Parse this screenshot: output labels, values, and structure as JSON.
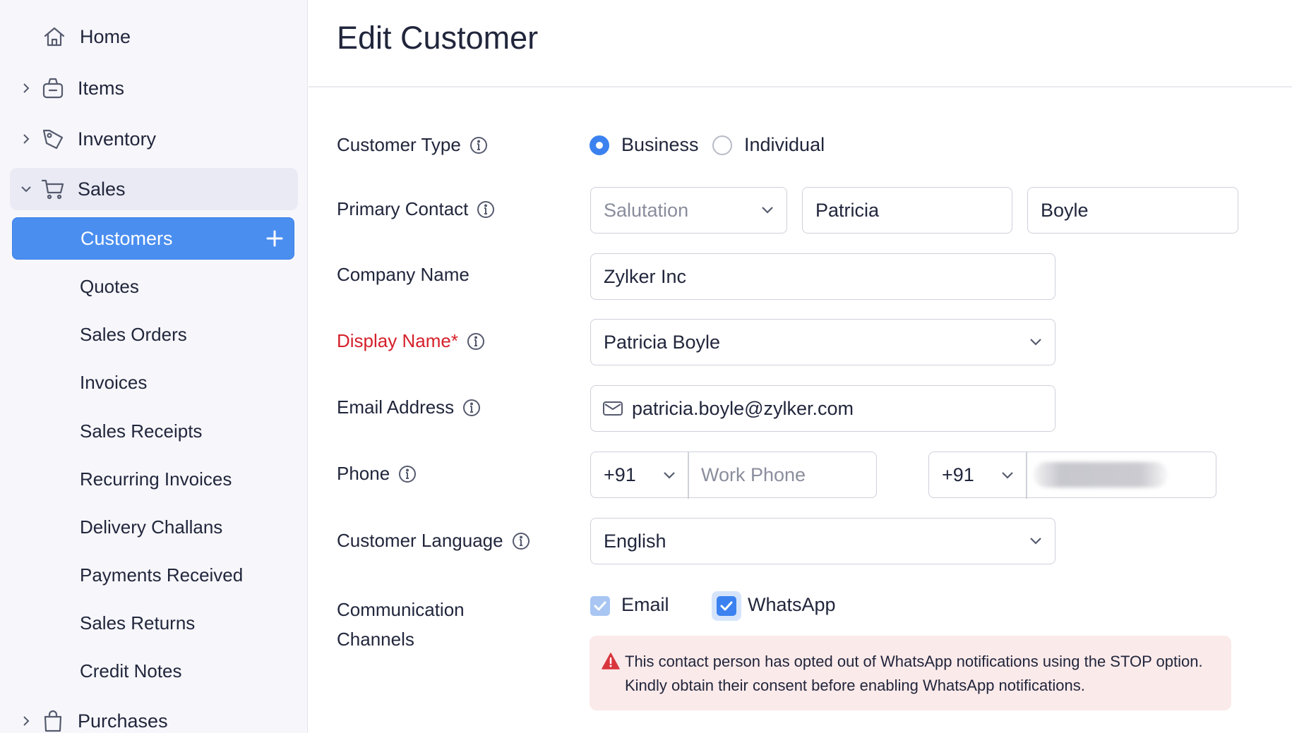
{
  "sidebar": {
    "items": [
      {
        "label": "Home",
        "icon": "home-icon"
      },
      {
        "label": "Items",
        "icon": "basket-icon"
      },
      {
        "label": "Inventory",
        "icon": "tag-icon"
      },
      {
        "label": "Sales",
        "icon": "cart-icon"
      },
      {
        "label": "Purchases",
        "icon": "shopping-bag-icon"
      }
    ],
    "sales_sub": [
      {
        "label": "Customers",
        "active": true
      },
      {
        "label": "Quotes"
      },
      {
        "label": "Sales Orders"
      },
      {
        "label": "Invoices"
      },
      {
        "label": "Sales Receipts"
      },
      {
        "label": "Recurring Invoices"
      },
      {
        "label": "Delivery Challans"
      },
      {
        "label": "Payments Received"
      },
      {
        "label": "Sales Returns"
      },
      {
        "label": "Credit Notes"
      }
    ]
  },
  "page": {
    "title": "Edit Customer"
  },
  "form": {
    "customer_type": {
      "label": "Customer Type",
      "options": [
        "Business",
        "Individual"
      ],
      "selected": "Business"
    },
    "primary_contact": {
      "label": "Primary Contact",
      "salutation_placeholder": "Salutation",
      "first_name": "Patricia",
      "last_name": "Boyle"
    },
    "company_name": {
      "label": "Company Name",
      "value": "Zylker Inc"
    },
    "display_name": {
      "label": "Display Name*",
      "value": "Patricia Boyle"
    },
    "email": {
      "label": "Email Address",
      "value": "patricia.boyle@zylker.com"
    },
    "phone": {
      "label": "Phone",
      "work_code": "+91",
      "work_placeholder": "Work Phone",
      "mobile_code": "+91"
    },
    "language": {
      "label": "Customer Language",
      "value": "English"
    },
    "channels": {
      "label_line1": "Communication",
      "label_line2": "Channels",
      "email_label": "Email",
      "email_checked": true,
      "whatsapp_label": "WhatsApp",
      "whatsapp_checked": true
    },
    "alert": {
      "text": "This contact person has opted out of WhatsApp notifications using the STOP option. Kindly obtain their consent before enabling WhatsApp notifications."
    }
  },
  "colors": {
    "accent": "#3b82f0",
    "active_nav": "#4a8ef0",
    "required": "#d6202b",
    "alert_bg": "#fbeaea",
    "alert_icon": "#d9363e"
  }
}
